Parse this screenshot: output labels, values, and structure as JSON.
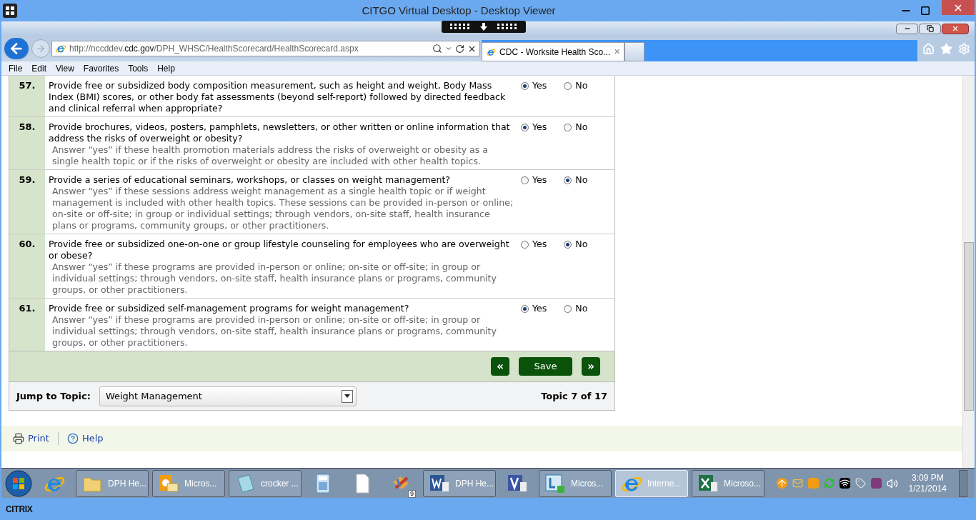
{
  "window": {
    "title": "CITGO Virtual Desktop - Desktop Viewer"
  },
  "browser": {
    "address": "http://nccddev.**cdc.gov**/DPH_WHSC/HealthScorecard/HealthScorecard.aspx",
    "tabs": [
      {
        "label": "CDC - Worksite Health Sco...",
        "close": "×",
        "selected": true
      }
    ],
    "menu": [
      "File",
      "Edit",
      "View",
      "Favorites",
      "Tools",
      "Help"
    ]
  },
  "questions": [
    {
      "number": "57.",
      "text": "Provide free or subsidized body composition measurement, such as height and weight, Body Mass Index (BMI) scores, or other body fat assessments (beyond self-report) followed by directed feedback and clinical referral when appropriate?",
      "options": [
        {
          "label": "Yes",
          "selected": true
        },
        {
          "label": "No",
          "selected": false
        }
      ]
    },
    {
      "number": "58.",
      "text": "Provide brochures, videos, posters, pamphlets, newsletters, or other written or online information that address the risks of overweight or obesity?",
      "hint": "Answer “yes” if these health promotion materials address the risks of overweight or obesity as a single health topic or if the risks of overweight or obesity are included with other health topics.",
      "options": [
        {
          "label": "Yes",
          "selected": true
        },
        {
          "label": "No",
          "selected": false
        }
      ]
    },
    {
      "number": "59.",
      "text": "Provide a series of educational seminars, workshops, or classes on weight management?",
      "hint": "Answer “yes” if these sessions address weight management as a single health topic or if weight management is included with other health topics. These sessions can be provided in-person or online; on-site or off-site; in group or individual settings; through vendors, on-site staff, health insurance plans or programs, community groups, or other practitioners.",
      "options": [
        {
          "label": "Yes",
          "selected": false
        },
        {
          "label": "No",
          "selected": true
        }
      ]
    },
    {
      "number": "60.",
      "text": "Provide free or subsidized one-on-one or group lifestyle counseling for employees who are overweight or obese?",
      "hint": "Answer “yes” if these programs are provided in-person or online; on-site or off-site; in group or individual settings; through vendors, on-site staff, health insurance plans or programs, community groups, or other practitioners.",
      "options": [
        {
          "label": "Yes",
          "selected": false
        },
        {
          "label": "No",
          "selected": true
        }
      ]
    },
    {
      "number": "61.",
      "text": "Provide free or subsidized self-management programs for weight management?",
      "hint": "Answer “yes” if these programs are provided in-person or online; on-site or off-site; in group or individual settings; through vendors, on-site staff, health insurance plans or programs, community groups, or other practitioners.",
      "options": [
        {
          "label": "Yes",
          "selected": true
        },
        {
          "label": "No",
          "selected": false
        }
      ]
    }
  ],
  "nav": {
    "previous": "«",
    "save": "Save",
    "next": "»"
  },
  "jump": {
    "label": "Jump to Topic:",
    "value": "Weight Management",
    "position": "Topic 7 of 17"
  },
  "footer_links": [
    {
      "kind": "print",
      "label": "Print"
    },
    {
      "kind": "help",
      "label": "Help"
    }
  ],
  "taskbar": {
    "items": [
      {
        "kind": "ie"
      },
      {
        "kind": "folder",
        "label": "DPH He...",
        "selected": false
      },
      {
        "kind": "outlook",
        "label": "Micros...",
        "selected": false
      },
      {
        "kind": "notepad",
        "label": "crocker ...",
        "selected": false
      },
      {
        "kind": "calculator"
      },
      {
        "kind": "file"
      },
      {
        "kind": "tool",
        "badge": "9"
      },
      {
        "kind": "word",
        "label": "DPH He...",
        "selected": false
      },
      {
        "kind": "visio"
      },
      {
        "kind": "lync",
        "label": "Micros...",
        "selected": false
      },
      {
        "kind": "ie",
        "label": "Interne...",
        "selected": true
      },
      {
        "kind": "excel",
        "label": "Microso...",
        "selected": false
      }
    ],
    "time": "3:09 PM",
    "date": "1/21/2014"
  },
  "citrix": {
    "logo": "CITRIX"
  }
}
